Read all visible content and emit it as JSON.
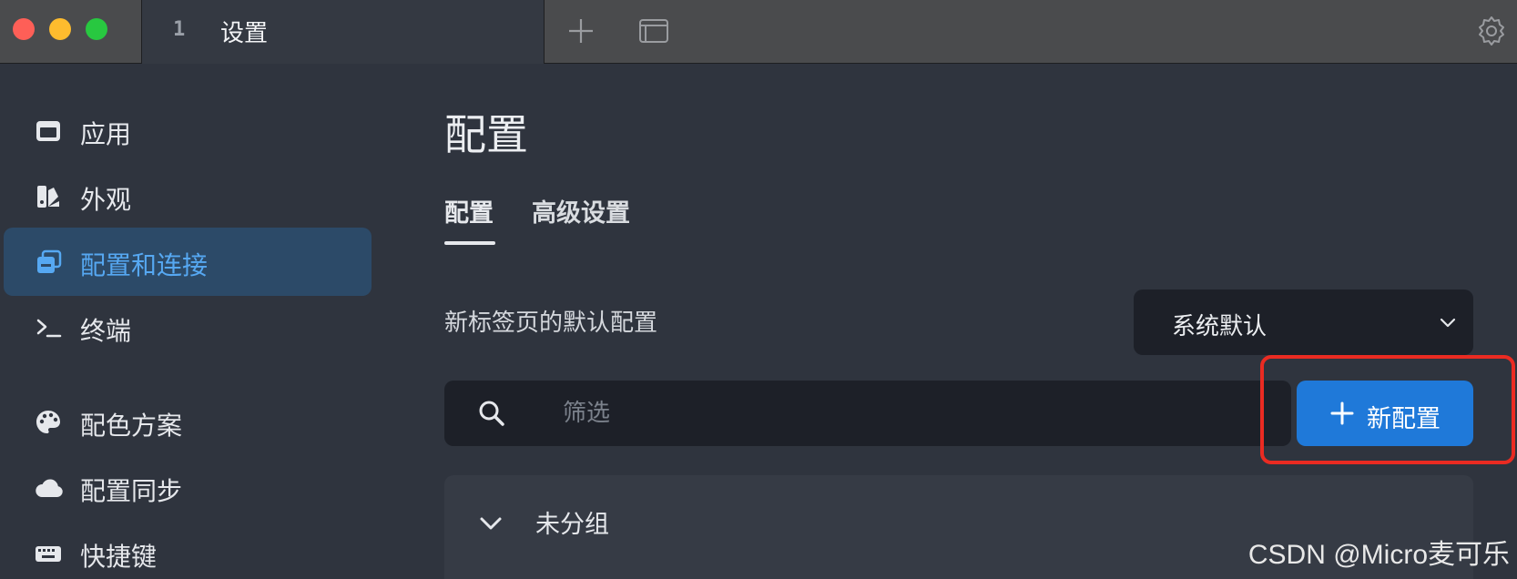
{
  "titlebar": {
    "tab_number": "1",
    "tab_title": "设置"
  },
  "sidebar": {
    "items": [
      {
        "label": "应用",
        "icon": "window-icon"
      },
      {
        "label": "外观",
        "icon": "palette-swatch-icon"
      },
      {
        "label": "配置和连接",
        "icon": "profiles-icon",
        "active": true
      },
      {
        "label": "终端",
        "icon": "terminal-icon"
      },
      {
        "label": "配色方案",
        "icon": "color-palette-icon"
      },
      {
        "label": "配置同步",
        "icon": "cloud-icon"
      },
      {
        "label": "快捷键",
        "icon": "keyboard-icon"
      }
    ]
  },
  "main": {
    "title": "配置",
    "tabs": [
      {
        "label": "配置",
        "active": true
      },
      {
        "label": "高级设置"
      }
    ],
    "default_profile": {
      "label": "新标签页的默认配置",
      "value": "系统默认"
    },
    "filter": {
      "placeholder": "筛选"
    },
    "new_button": {
      "label": "新配置"
    },
    "group": {
      "label": "未分组"
    }
  },
  "watermark": "CSDN @Micro麦可乐",
  "colors": {
    "accent": "#1f79d9",
    "active_nav_bg": "#2c4a68",
    "active_nav_text": "#56a8f2",
    "highlight": "#ea2b22"
  }
}
